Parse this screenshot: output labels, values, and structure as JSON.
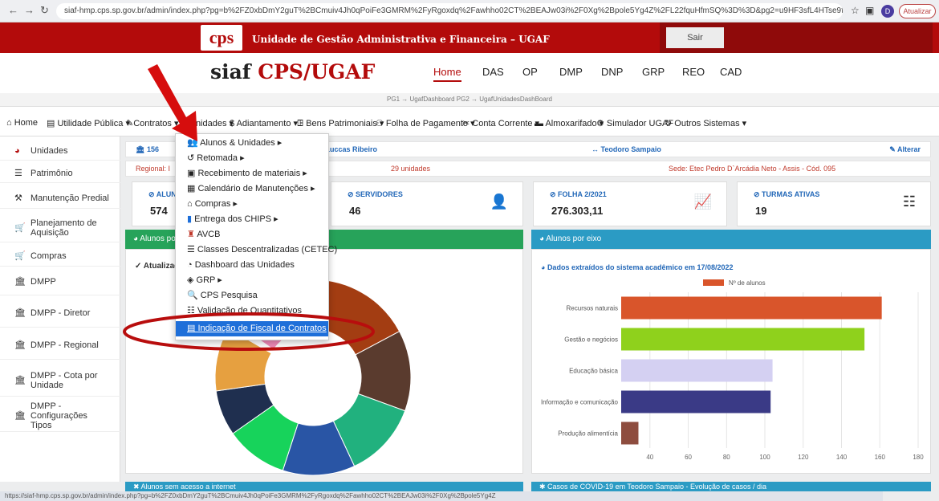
{
  "browser": {
    "url": "siaf-hmp.cps.sp.gov.br/admin/index.php?pg=b%2FZ0xbDmY2guT%2BCmuiv4Jh0qPoiFe3GMRM%2FyRgoxdq%2Fawhho02CT%2BEAJw03i%2F0Xg%2Bpole5Yg4Z%2FL22fquHfmSQ%3D%3D&pg2=u9HF3sfL4HTse9fkoWDC%2BKz9VAmkubxCravL7JdW...",
    "update_label": "Atualizar",
    "profile_initial": "D"
  },
  "banner": {
    "logo": "cps",
    "title": "Unidade de Gestão Administrativa e Financeira – UGAF",
    "logout": "Sair"
  },
  "header": {
    "app_prefix": "siaf ",
    "app_name": "CPS/UGAF",
    "nav": [
      "Home",
      "DAS",
      "OP",
      "DMP",
      "DNP",
      "GRP",
      "REO",
      "CAD"
    ],
    "breadcrumb": "PG1 → UgafDashboard PG2 → UgafUnidadesDashBoard"
  },
  "menubar": {
    "items": [
      "Home",
      "Utilidade Pública ▾",
      "Contratos ▾",
      "Unidades ▾",
      "$ Adiantamento ▾",
      "Bens Patrimoniais ▾",
      "Folha de Pagamento ▾",
      "Conta Corrente ▾",
      "Almoxarifado ▾",
      "Simulador UGAF",
      "Outros Sistemas ▾"
    ]
  },
  "sidebar": {
    "items": [
      "Unidades",
      "Patrimônio",
      "Manutenção Predial",
      "Planejamento de Aquisição",
      "Compras",
      "DMPP",
      "DMPP - Diretor",
      "DMPP - Regional",
      "DMPP - Cota por Unidade",
      "DMPP - Configurações Tipos"
    ]
  },
  "info": {
    "code": "156",
    "school": "ora Nair Luccas Ribeiro",
    "city": "Teodoro Sampaio",
    "edit": "Alterar",
    "regional": "Regional: I",
    "units": "29 unidades",
    "sede": "Sede: Etec Pedro D`Arcádia Neto - Assis - Cód. 095"
  },
  "cards": [
    {
      "label": "ALUN",
      "value": "574"
    },
    {
      "label": "SERVIDORES",
      "value": "46"
    },
    {
      "label": "FOLHA 2/2021",
      "value": "276.303,11"
    },
    {
      "label": "TURMAS ATIVAS",
      "value": "19"
    }
  ],
  "panels": {
    "left_title": "Alunos po",
    "left_updated": "Atualizad",
    "right_title": "Alunos por eixo",
    "right_subtitle": "Dados extraídos do sistema acadêmico em 17/08/2022",
    "bottom_left": "Alunos sem acesso a internet",
    "bottom_right": "Casos de COVID-19 em Teodoro Sampaio - Evolução de casos / dia"
  },
  "dropdown": {
    "items": [
      "Alunos & Unidades ▸",
      "Retomada ▸",
      "Recebimento de materiais ▸",
      "Calendário de Manutenções ▸",
      "Compras ▸",
      "Entrega dos CHIPS ▸",
      "AVCB",
      "Classes Descentralizadas (CETEC)",
      "Dashboard das Unidades",
      "GRP ▸",
      "CPS Pesquisa",
      "Validação de Quantitativos",
      "Indicação de Fiscal de Contratos"
    ],
    "selected_index": 12
  },
  "chart_data": [
    {
      "type": "bar",
      "orientation": "horizontal",
      "legend": "Nº de alunos",
      "categories": [
        "Recursos naturais",
        "Gestão e negócios",
        "Educação básica",
        "Informação e comunicação",
        "Produção alimentícia"
      ],
      "values": [
        161,
        152,
        104,
        103,
        34
      ],
      "colors": [
        "#d9552b",
        "#8fd11c",
        "#d4d0f2",
        "#3a3a86",
        "#8e4d3f"
      ],
      "xticks": [
        40,
        60,
        80,
        100,
        120,
        140,
        160,
        180
      ],
      "xlim": [
        25,
        180
      ]
    },
    {
      "type": "pie",
      "style": "donut",
      "slice_colors": [
        "#f08ab8",
        "#a33d12",
        "#5a3b2e",
        "#21b17e",
        "#2955a5",
        "#17d35b",
        "#1f2f4f",
        "#e6a040"
      ]
    }
  ],
  "statusbar": "https://siaf-hmp.cps.sp.gov.br/admin/index.php?pg=b%2FZ0xbDmY2guT%2BCmuiv4Jh0qPoiFe3GMRM%2FyRgoxdq%2Fawhho02CT%2BEAJw03i%2F0Xg%2Bpole5Yg4Z"
}
